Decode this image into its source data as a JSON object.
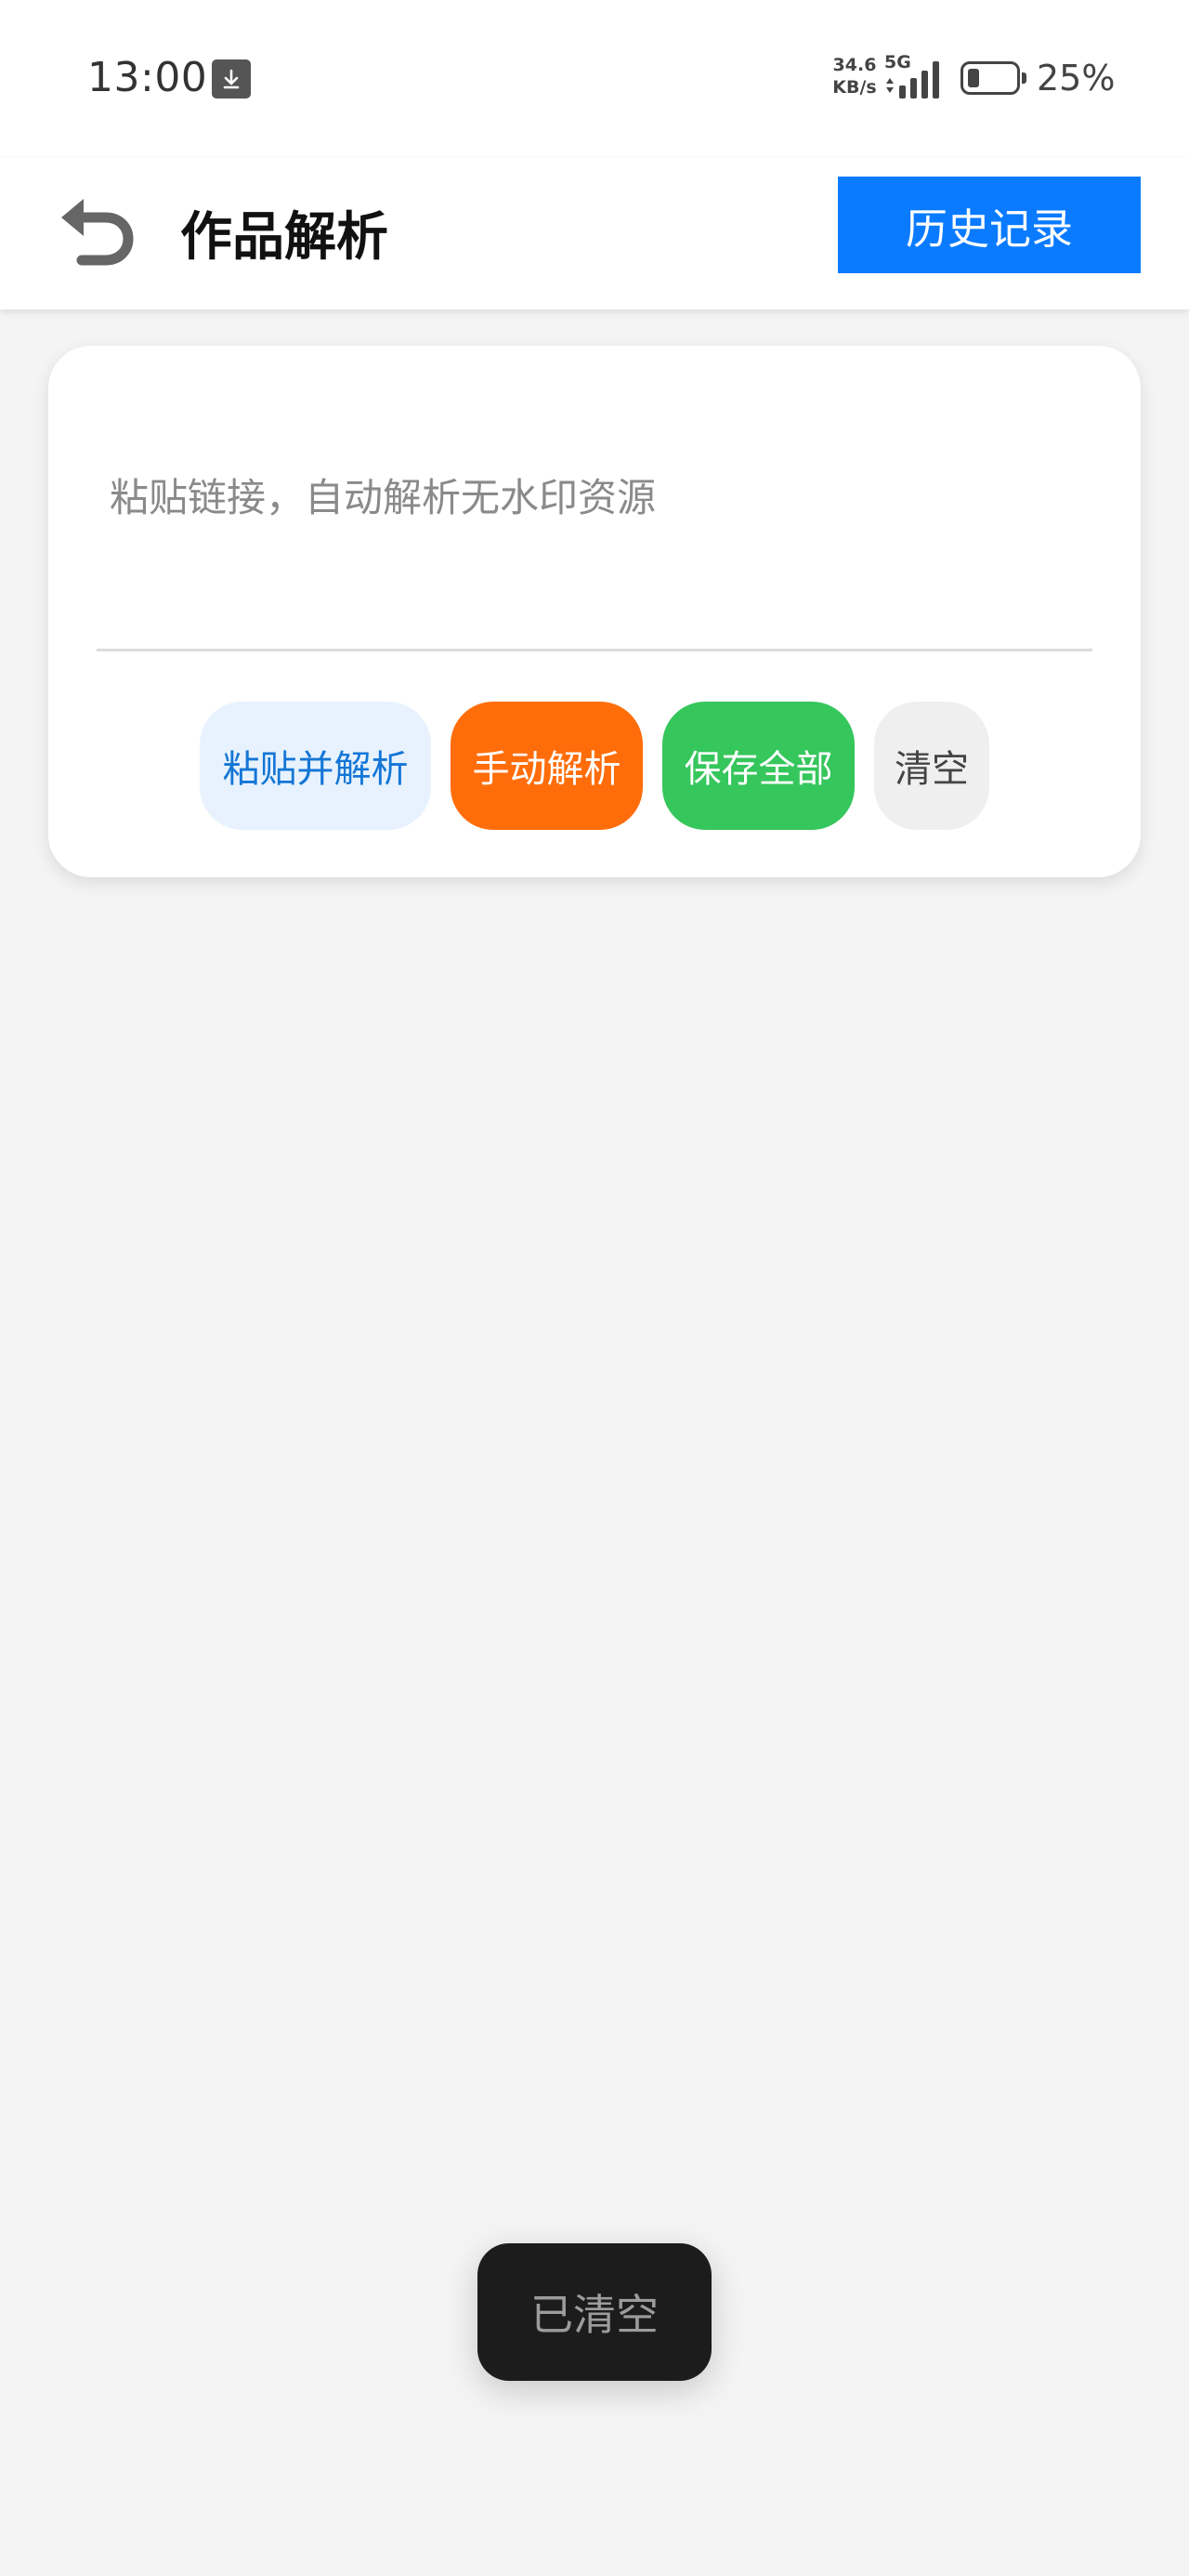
{
  "status_bar": {
    "time": "13:00",
    "download_icon": "download-arrow-icon",
    "net_speed_value": "34.6",
    "net_speed_unit": "KB/s",
    "network_type": "5G",
    "battery_percent": "25%",
    "battery_level": 0.25
  },
  "toolbar": {
    "back_icon": "undo-arrow-icon",
    "title": "作品解析",
    "history_button": "历史记录"
  },
  "card": {
    "input_value": "",
    "input_placeholder": "粘贴链接，自动解析无水印资源",
    "buttons": [
      {
        "label": "粘贴并解析",
        "color": "#1476d6",
        "background": "#e7f2fe"
      },
      {
        "label": "手动解析",
        "color": "#ffffff",
        "background": "#ff6d0a"
      },
      {
        "label": "保存全部",
        "color": "#ffffff",
        "background": "#35c65c"
      },
      {
        "label": "清空",
        "color": "#444444",
        "background": "#efefef"
      }
    ]
  },
  "toast": {
    "message": "已清空"
  },
  "colors": {
    "accent": "#0a7bff",
    "background": "#f4f4f4"
  }
}
